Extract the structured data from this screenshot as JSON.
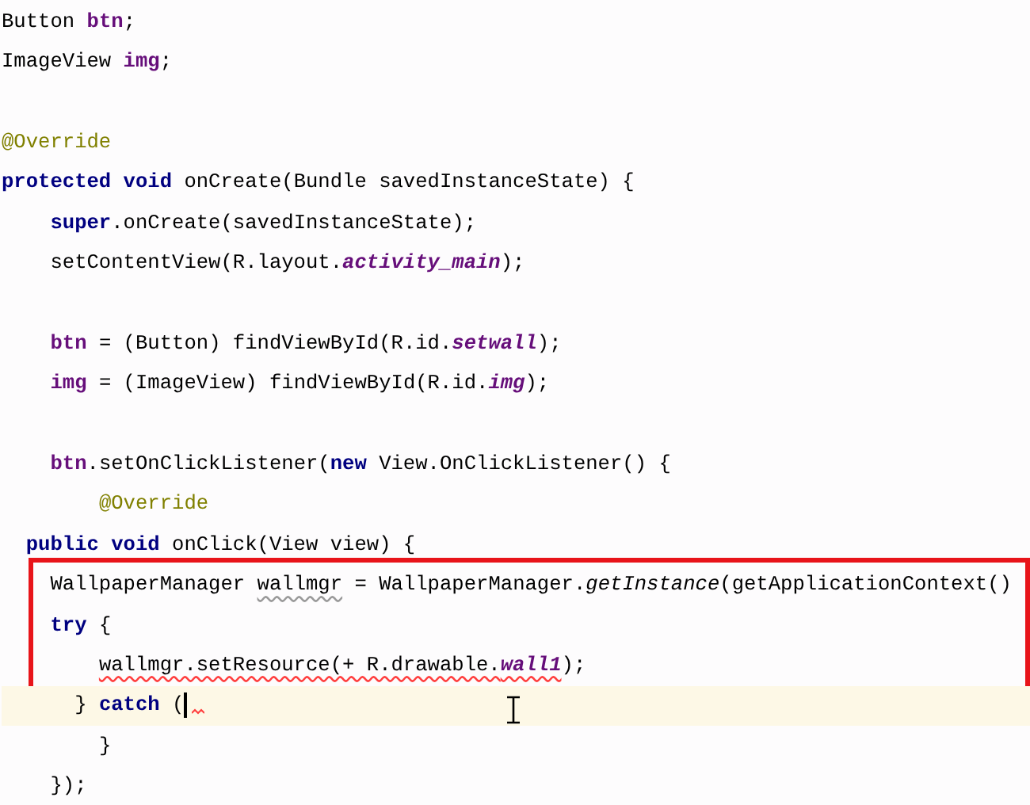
{
  "code_lines": [
    {
      "current": false,
      "highlighted": false,
      "tokens": [
        {
          "text": "Button ",
          "kind": "plain"
        },
        {
          "text": "btn",
          "kind": "field"
        },
        {
          "text": ";",
          "kind": "plain"
        }
      ]
    },
    {
      "current": false,
      "highlighted": false,
      "tokens": [
        {
          "text": "ImageView ",
          "kind": "plain"
        },
        {
          "text": "img",
          "kind": "field"
        },
        {
          "text": ";",
          "kind": "plain"
        }
      ]
    },
    {
      "current": false,
      "highlighted": false
    },
    {
      "current": false,
      "highlighted": false,
      "tokens": [
        {
          "text": "@Override",
          "kind": "annotation"
        }
      ]
    },
    {
      "current": false,
      "highlighted": false,
      "tokens": [
        {
          "text": "protected void ",
          "kind": "keyword"
        },
        {
          "text": "onCreate(Bundle savedInstanceState) {",
          "kind": "plain"
        }
      ]
    },
    {
      "current": false,
      "highlighted": false,
      "tokens": [
        {
          "text": "    super",
          "kind": "keyword"
        },
        {
          "text": ".onCreate(savedInstanceState);",
          "kind": "plain"
        }
      ]
    },
    {
      "current": false,
      "highlighted": false,
      "tokens": [
        {
          "text": "    setContentView(R.layout.",
          "kind": "plain"
        },
        {
          "text": "activity_main",
          "kind": "static_field"
        },
        {
          "text": ");",
          "kind": "plain"
        }
      ]
    },
    {
      "current": false,
      "highlighted": false
    },
    {
      "current": false,
      "highlighted": false,
      "tokens": [
        {
          "text": "    btn",
          "kind": "field"
        },
        {
          "text": " = (Button) findViewById(R.id.",
          "kind": "plain"
        },
        {
          "text": "setwall",
          "kind": "static_field"
        },
        {
          "text": ");",
          "kind": "plain"
        }
      ]
    },
    {
      "current": false,
      "highlighted": false,
      "tokens": [
        {
          "text": "    img",
          "kind": "field"
        },
        {
          "text": " = (ImageView) findViewById(R.id.",
          "kind": "plain"
        },
        {
          "text": "img",
          "kind": "static_field"
        },
        {
          "text": ");",
          "kind": "plain"
        }
      ]
    },
    {
      "current": false,
      "highlighted": false
    },
    {
      "current": false,
      "highlighted": false,
      "tokens": [
        {
          "text": "    btn",
          "kind": "field"
        },
        {
          "text": ".setOnClickListener(",
          "kind": "plain"
        },
        {
          "text": "new ",
          "kind": "keyword"
        },
        {
          "text": "View.OnClickListener() {",
          "kind": "plain"
        }
      ]
    },
    {
      "current": false,
      "highlighted": false,
      "tokens": [
        {
          "text": "        @Override",
          "kind": "annotation"
        }
      ]
    },
    {
      "current": false,
      "highlighted": false,
      "tokens": [
        {
          "text": "  public void ",
          "kind": "keyword"
        },
        {
          "text": "onClick(View view) {",
          "kind": "plain"
        }
      ]
    },
    {
      "current": false,
      "highlighted": true,
      "tokens": [
        {
          "text": "    WallpaperManager ",
          "kind": "plain"
        },
        {
          "text": "wallmgr",
          "kind": "plain",
          "warning": true
        },
        {
          "text": " = WallpaperManager.",
          "kind": "plain"
        },
        {
          "text": "getInstance",
          "kind": "static_method"
        },
        {
          "text": "(getApplicationContext()",
          "kind": "plain"
        }
      ]
    },
    {
      "current": false,
      "highlighted": true,
      "tokens": [
        {
          "text": "    try ",
          "kind": "keyword"
        },
        {
          "text": "{",
          "kind": "plain"
        }
      ]
    },
    {
      "current": false,
      "highlighted": true,
      "tokens": [
        {
          "text": "        wallmgr.setResource(+ R.drawable.",
          "kind": "plain",
          "error": true
        },
        {
          "text": "wall1",
          "kind": "static_field",
          "error": true
        },
        {
          "text": ");",
          "kind": "plain"
        }
      ]
    },
    {
      "current": true,
      "highlighted": false,
      "tokens": [
        {
          "text": "      } ",
          "kind": "plain"
        },
        {
          "text": "catch ",
          "kind": "keyword"
        },
        {
          "text": "(",
          "kind": "plain",
          "caret": true,
          "error_mark": true
        }
      ]
    },
    {
      "current": false,
      "highlighted": false,
      "tokens": [
        {
          "text": "        }",
          "kind": "plain"
        }
      ]
    },
    {
      "current": false,
      "highlighted": false,
      "tokens": [
        {
          "text": "    });",
          "kind": "plain"
        }
      ]
    }
  ]
}
